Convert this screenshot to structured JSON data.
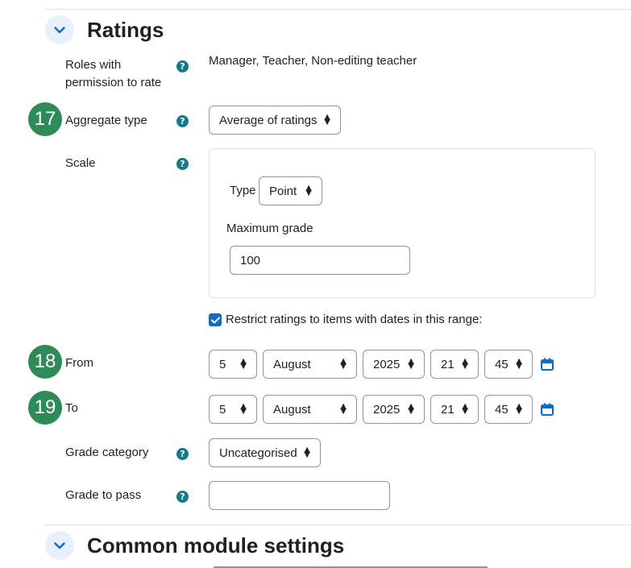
{
  "ratings_section": {
    "title": "Ratings"
  },
  "roles": {
    "label_line1": "Roles with",
    "label_line2": "permission to rate",
    "value": "Manager, Teacher, Non-editing teacher"
  },
  "aggregate": {
    "label": "Aggregate type",
    "value": "Average of ratings"
  },
  "scale": {
    "label": "Scale",
    "type_label": "Type",
    "type_value": "Point",
    "max_grade_label": "Maximum grade",
    "max_grade_value": "100"
  },
  "restrict": {
    "label": "Restrict ratings to items with dates in this range:",
    "checked": true
  },
  "from": {
    "label": "From",
    "day": "5",
    "month": "August",
    "year": "2025",
    "hour": "21",
    "minute": "45"
  },
  "to": {
    "label": "To",
    "day": "5",
    "month": "August",
    "year": "2025",
    "hour": "21",
    "minute": "45"
  },
  "grade_category": {
    "label": "Grade category",
    "value": "Uncategorised"
  },
  "grade_to_pass": {
    "label": "Grade to pass",
    "value": ""
  },
  "common_section": {
    "title": "Common module settings"
  },
  "badges": {
    "b17": "17",
    "b18": "18",
    "b19": "19"
  },
  "colors": {
    "primary": "#0f6cbf",
    "help": "#117a8b",
    "badge": "#2e8b57"
  }
}
